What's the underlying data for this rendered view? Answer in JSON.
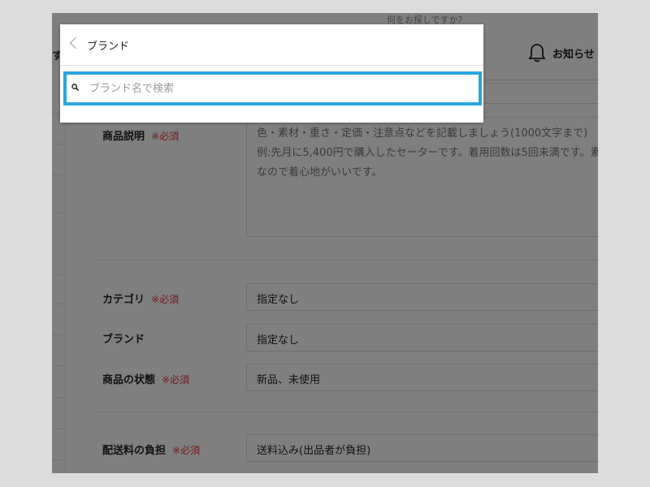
{
  "header": {
    "search_hint": "何をお探しですか?",
    "left_fragment": "す",
    "notice_label": "お知らせ"
  },
  "form": {
    "description": {
      "label": "商品説明",
      "required": "※必須",
      "placeholder_lines": [
        "色・素材・重さ・定価・注意点などを記載しましょう(1000文字まで)",
        "例:先月に5,400円で購入したセーターです。着用回数は5回未満です。素",
        "なので着心地がいいです。"
      ]
    },
    "category": {
      "label": "カテゴリ",
      "required": "※必須",
      "value": "指定なし"
    },
    "brand": {
      "label": "ブランド",
      "value": "指定なし"
    },
    "condition": {
      "label": "商品の状態",
      "required": "※必須",
      "value": "新品、未使用"
    },
    "shipping": {
      "label": "配送料の負担",
      "required": "※必須",
      "value": "送料込み(出品者が負担)"
    }
  },
  "modal": {
    "title": "ブランド",
    "search_placeholder": "ブランド名で検索"
  },
  "colors": {
    "accent_border": "#29a6e0",
    "required_red": "#e53935",
    "overlay": "rgba(0,0,0,0.5)"
  }
}
